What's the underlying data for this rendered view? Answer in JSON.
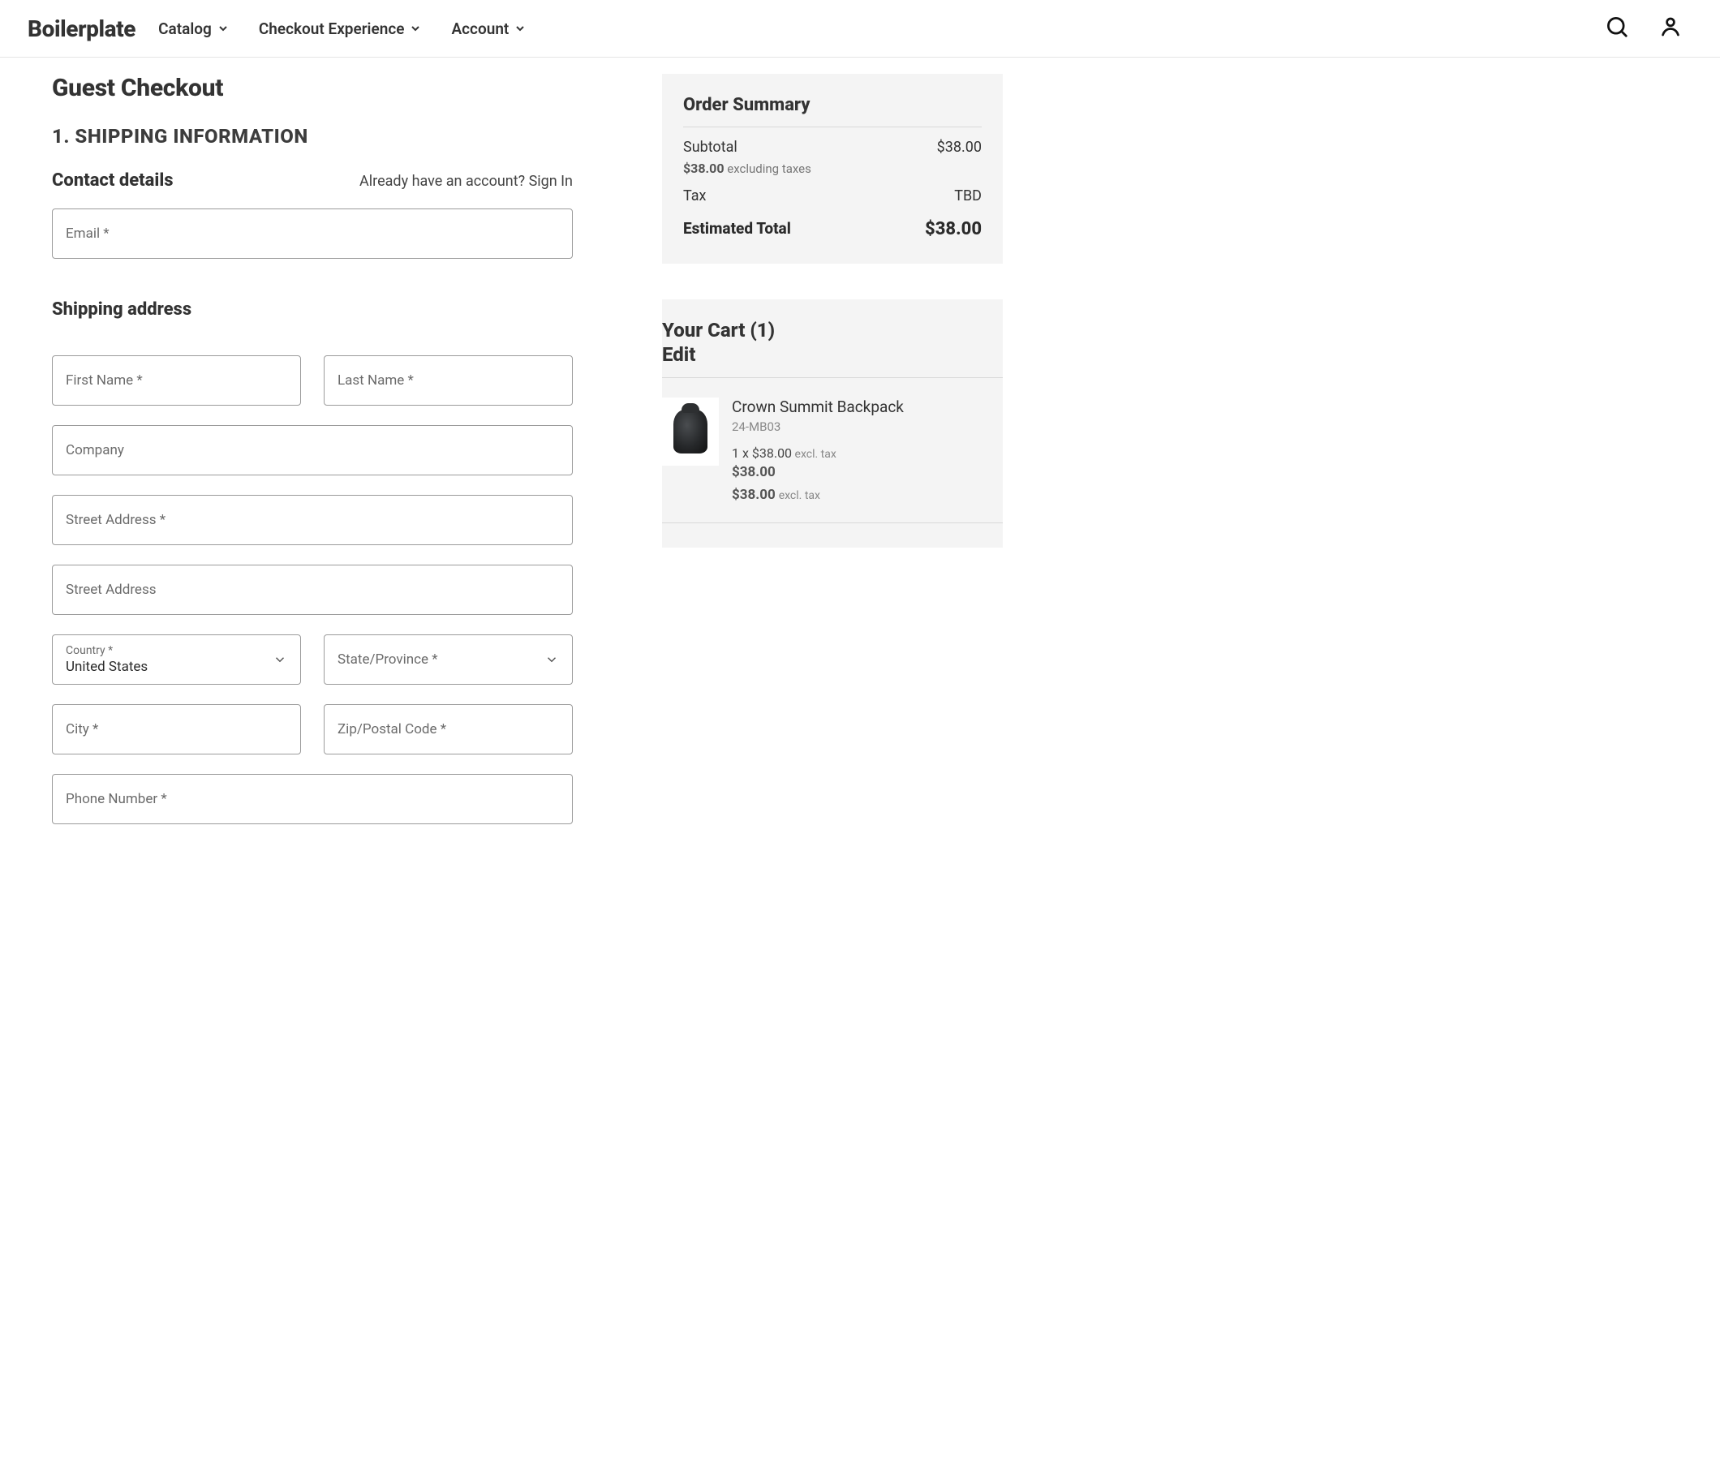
{
  "header": {
    "brand": "Boilerplate",
    "nav": {
      "catalog": "Catalog",
      "checkout_exp": "Checkout Experience",
      "account": "Account"
    }
  },
  "page": {
    "title": "Guest Checkout",
    "step_title": "1. SHIPPING INFORMATION"
  },
  "contact": {
    "title": "Contact details",
    "signin_prompt": "Already have an account? ",
    "signin_link": "Sign In",
    "email_label": "Email *"
  },
  "shipping": {
    "title": "Shipping address",
    "first_name": "First Name *",
    "last_name": "Last Name *",
    "company": "Company",
    "street1": "Street Address *",
    "street2": "Street Address",
    "country_label": "Country *",
    "country_value": "United States",
    "state_label": "State/Province *",
    "city": "City *",
    "zip": "Zip/Postal Code *",
    "phone": "Phone Number *"
  },
  "summary": {
    "title": "Order Summary",
    "subtotal_label": "Subtotal",
    "subtotal_value": "$38.00",
    "sub_note_amt": "$38.00",
    "sub_note_text": " excluding taxes",
    "tax_label": "Tax",
    "tax_value": "TBD",
    "total_label": "Estimated Total",
    "total_value": "$38.00"
  },
  "cart": {
    "title": "Your Cart (1)",
    "edit": "Edit",
    "items": [
      {
        "name": "Crown Summit Backpack",
        "sku": "24-MB03",
        "qty_line": "1 x $38.00",
        "qty_excl": " excl. tax",
        "price": "$38.00",
        "line_total": "$38.00",
        "line_excl": "excl. tax"
      }
    ]
  }
}
